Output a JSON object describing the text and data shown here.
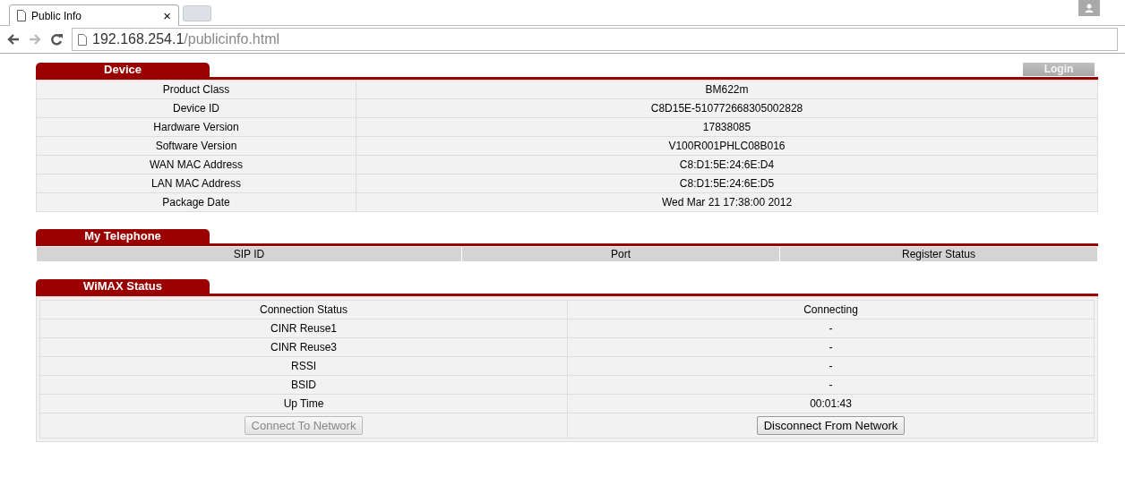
{
  "browser": {
    "tab_title": "Public Info",
    "tab_close": "×",
    "url_host": "192.168.254.1",
    "url_path": "/publicinfo.html"
  },
  "login_button": "Login",
  "device": {
    "title": "Device",
    "rows": [
      {
        "label": "Product Class",
        "value": "BM622m"
      },
      {
        "label": "Device ID",
        "value": "C8D15E-510772668305002828"
      },
      {
        "label": "Hardware Version",
        "value": "17838085"
      },
      {
        "label": "Software Version",
        "value": "V100R001PHLC08B016"
      },
      {
        "label": "WAN MAC Address",
        "value": "C8:D1:5E:24:6E:D4"
      },
      {
        "label": "LAN MAC Address",
        "value": "C8:D1:5E:24:6E:D5"
      },
      {
        "label": "Package Date",
        "value": "Wed Mar 21 17:38:00 2012"
      }
    ]
  },
  "telephone": {
    "title": "My Telephone",
    "columns": [
      "SIP ID",
      "Port",
      "Register Status"
    ]
  },
  "wimax": {
    "title": "WiMAX Status",
    "rows": [
      {
        "label": "Connection Status",
        "value": "Connecting"
      },
      {
        "label": "CINR Reuse1",
        "value": "-"
      },
      {
        "label": "CINR Reuse3",
        "value": "-"
      },
      {
        "label": "RSSI",
        "value": "-"
      },
      {
        "label": "BSID",
        "value": "-"
      },
      {
        "label": "Up Time",
        "value": "00:01:43"
      }
    ],
    "buttons": [
      {
        "label": "Connect To Network",
        "disabled": true
      },
      {
        "label": "Disconnect From Network",
        "disabled": false
      }
    ]
  }
}
